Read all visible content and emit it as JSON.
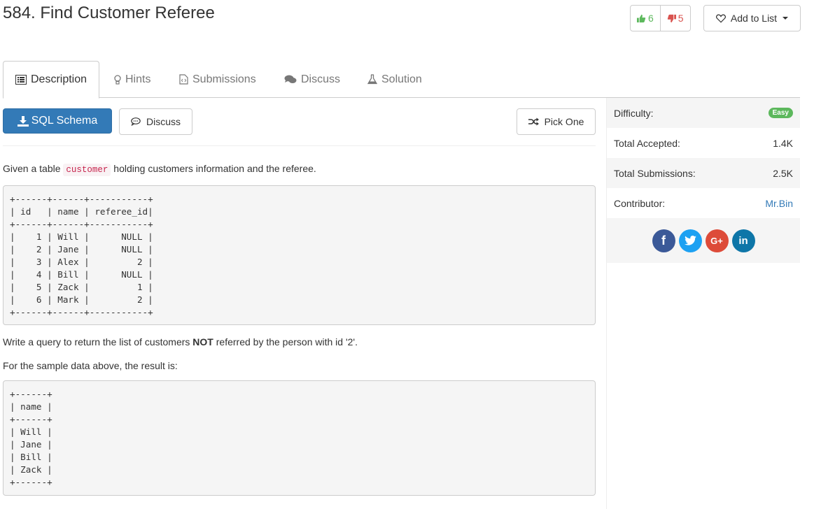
{
  "problem": {
    "title": "584. Find Customer Referee"
  },
  "votes": {
    "up": "6",
    "down": "5"
  },
  "add_to_list": "Add to List",
  "tabs": [
    {
      "label": "Description",
      "icon": "list-icon"
    },
    {
      "label": "Hints",
      "icon": "lightbulb-icon"
    },
    {
      "label": "Submissions",
      "icon": "code-file-icon"
    },
    {
      "label": "Discuss",
      "icon": "comments-icon"
    },
    {
      "label": "Solution",
      "icon": "flask-icon"
    }
  ],
  "actions": {
    "sql_schema": "SQL Schema",
    "discuss": "Discuss",
    "pick_one": "Pick One"
  },
  "description": {
    "intro_before": "Given a table ",
    "intro_code": "customer",
    "intro_after": " holding customers information and the referee.",
    "table_input": "+------+------+-----------+\n| id   | name | referee_id|\n+------+------+-----------+\n|    1 | Will |      NULL |\n|    2 | Jane |      NULL |\n|    3 | Alex |         2 |\n|    4 | Bill |      NULL |\n|    5 | Zack |         1 |\n|    6 | Mark |         2 |\n+------+------+-----------+",
    "query_before": "Write a query to return the list of customers ",
    "query_bold": "NOT",
    "query_after": " referred by the person with id '2'.",
    "result_intro": "For the sample data above, the result is:",
    "table_output": "+------+\n| name |\n+------+\n| Will |\n| Jane |\n| Bill |\n| Zack |\n+------+"
  },
  "sidebar": {
    "difficulty_label": "Difficulty:",
    "difficulty_value": "Easy",
    "accepted_label": "Total Accepted:",
    "accepted_value": "1.4K",
    "submissions_label": "Total Submissions:",
    "submissions_value": "2.5K",
    "contributor_label": "Contributor:",
    "contributor_value": "Mr.Bin",
    "share": [
      {
        "icon": "facebook-icon",
        "glyph": "f"
      },
      {
        "icon": "twitter-icon",
        "glyph": ""
      },
      {
        "icon": "google-plus-icon",
        "glyph": "G+"
      },
      {
        "icon": "linkedin-icon",
        "glyph": "in"
      }
    ]
  },
  "colors": {
    "primary": "#337ab7",
    "success": "#5cb85c",
    "danger": "#d9534f",
    "inline_code": "#c7254e"
  }
}
